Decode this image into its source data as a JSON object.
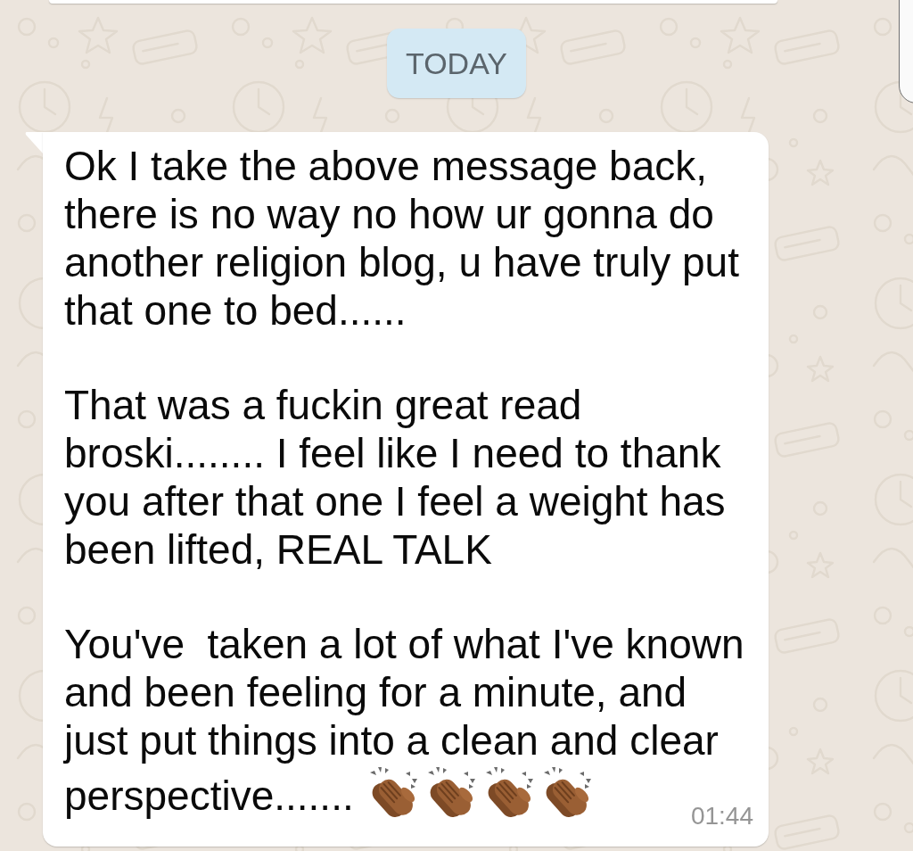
{
  "date_divider": {
    "label": "TODAY"
  },
  "message": {
    "paragraphs": [
      "Ok I take the above message back, there is no way no how ur gonna do another religion blog, u have truly put that one to bed......",
      "That was a fuckin great read broski........ I feel like I need to thank you after that one I feel a weight has been lifted, REAL TALK",
      "You've  taken a lot of what I've known and been feeling for a minute, and just put things into a clean and clear"
    ],
    "closing_line": "perspective.......",
    "emoji": [
      {
        "kind": "clapping-hands"
      },
      {
        "kind": "clapping-hands"
      },
      {
        "kind": "clapping-hands"
      },
      {
        "kind": "clapping-hands"
      }
    ],
    "time": "01:44"
  }
}
